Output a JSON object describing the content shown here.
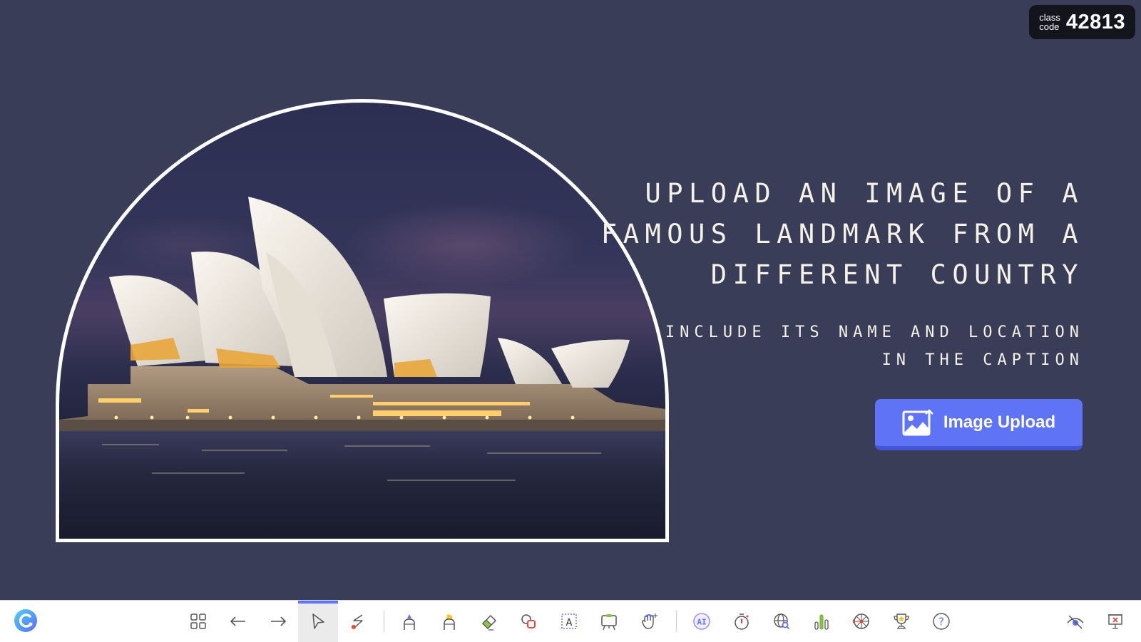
{
  "class_code": {
    "label_line1": "class",
    "label_line2": "code",
    "value": "42813"
  },
  "slide": {
    "image_alt": "Sydney Opera House at night",
    "headline": "UPLOAD AN IMAGE OF A FAMOUS LANDMARK FROM A DIFFERENT COUNTRY",
    "subline": "INCLUDE ITS NAME AND LOCATION IN THE CAPTION",
    "upload_button_label": "Image Upload"
  },
  "colors": {
    "background": "#393d57",
    "accent": "#5f73f7",
    "text": "#f5f1e6",
    "badge": "#14151c"
  },
  "toolbar": {
    "items": [
      {
        "name": "slides-grid",
        "icon": "grid-icon"
      },
      {
        "name": "previous",
        "icon": "arrow-left-icon"
      },
      {
        "name": "next",
        "icon": "arrow-right-icon"
      },
      {
        "name": "select",
        "icon": "cursor-icon",
        "active": true
      },
      {
        "name": "laser",
        "icon": "laser-pointer-icon"
      },
      {
        "name": "pen",
        "icon": "pen-icon"
      },
      {
        "name": "highlighter",
        "icon": "highlighter-icon"
      },
      {
        "name": "eraser",
        "icon": "eraser-icon"
      },
      {
        "name": "shapes",
        "icon": "shapes-icon"
      },
      {
        "name": "text",
        "icon": "text-box-icon"
      },
      {
        "name": "whiteboard",
        "icon": "whiteboard-icon"
      },
      {
        "name": "move",
        "icon": "hand-move-icon"
      },
      {
        "name": "ai",
        "icon": "ai-icon",
        "label": "AI"
      },
      {
        "name": "timer",
        "icon": "timer-icon"
      },
      {
        "name": "web-search",
        "icon": "globe-search-icon"
      },
      {
        "name": "poll",
        "icon": "bar-chart-icon"
      },
      {
        "name": "spinner-wheel",
        "icon": "wheel-icon"
      },
      {
        "name": "leaderboard",
        "icon": "trophy-icon"
      },
      {
        "name": "help",
        "icon": "help-icon",
        "label": "?"
      },
      {
        "name": "hide",
        "icon": "eye-off-icon"
      },
      {
        "name": "end-presentation",
        "icon": "end-presentation-icon"
      }
    ]
  }
}
